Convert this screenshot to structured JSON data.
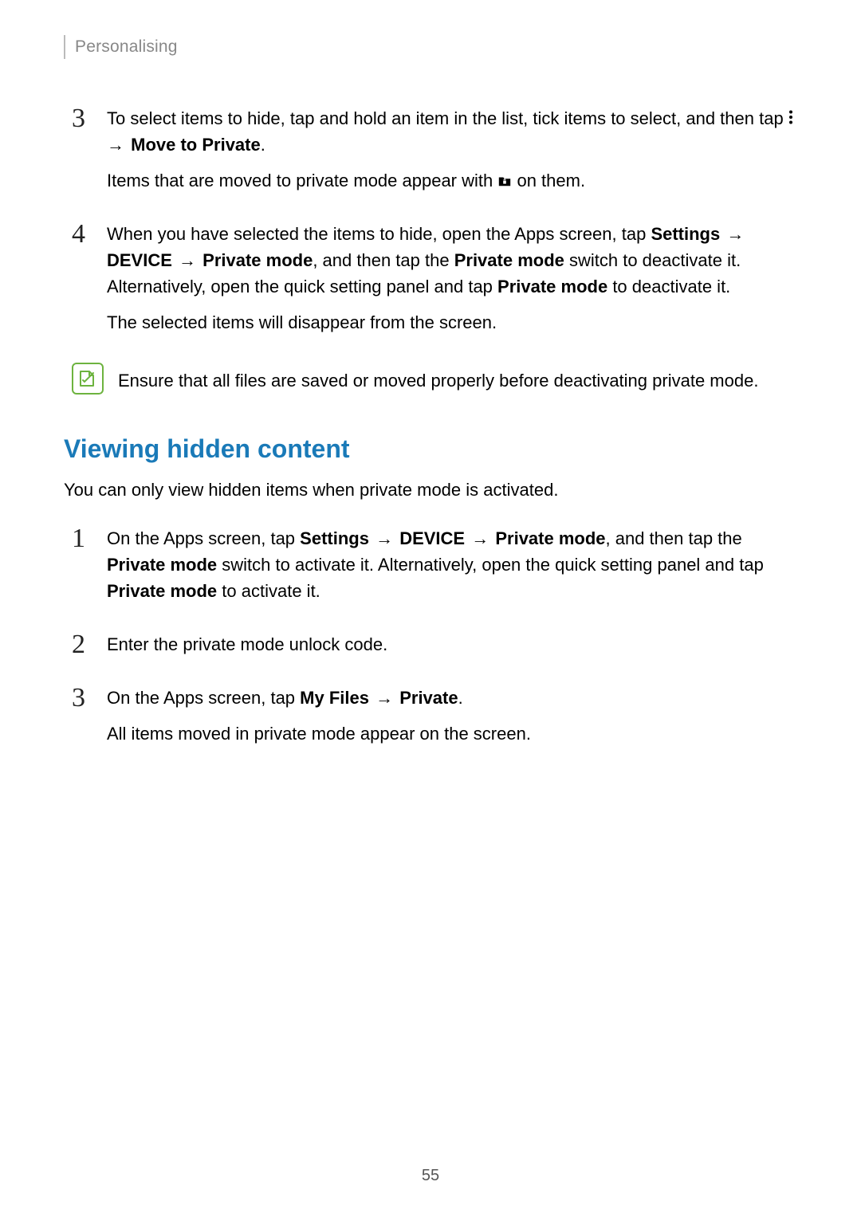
{
  "header": {
    "chapter": "Personalising"
  },
  "stepsA": {
    "s3": {
      "num": "3",
      "l1_a": "To select items to hide, tap and hold an item in the list, tick items to select, and then tap ",
      "l1_b": " → ",
      "l1_c": "Move to Private",
      "l1_d": ".",
      "p2_a": "Items that are moved to private mode appear with ",
      "p2_b": " on them."
    },
    "s4": {
      "num": "4",
      "l1_a": "When you have selected the items to hide, open the Apps screen, tap ",
      "l1_settings": "Settings",
      "l1_arrow1": " → ",
      "l1_device": "DEVICE",
      "l1_arrow2": " → ",
      "l1_private": "Private mode",
      "l1_mid": ", and then tap the ",
      "l1_private2": "Private mode",
      "l1_end": " switch to deactivate it. Alternatively, open the quick setting panel and tap ",
      "l1_private3": "Private mode",
      "l1_end2": " to deactivate it.",
      "p2": "The selected items will disappear from the screen."
    }
  },
  "note": {
    "text": "Ensure that all files are saved or moved properly before deactivating private mode."
  },
  "section": {
    "heading": "Viewing hidden content",
    "intro": "You can only view hidden items when private mode is activated."
  },
  "stepsB": {
    "s1": {
      "num": "1",
      "a": "On the Apps screen, tap ",
      "b": "Settings",
      "arrow": " → ",
      "c": "DEVICE",
      "d": "Private mode",
      "e": ", and then tap the ",
      "f": "Private mode",
      "g": " switch to activate it. Alternatively, open the quick setting panel and tap ",
      "h": "Private mode",
      "i": " to activate it."
    },
    "s2": {
      "num": "2",
      "text": "Enter the private mode unlock code."
    },
    "s3": {
      "num": "3",
      "a": "On the Apps screen, tap ",
      "b": "My Files",
      "arrow": " → ",
      "c": "Private",
      "d": ".",
      "p2": "All items moved in private mode appear on the screen."
    }
  },
  "page_number": "55"
}
